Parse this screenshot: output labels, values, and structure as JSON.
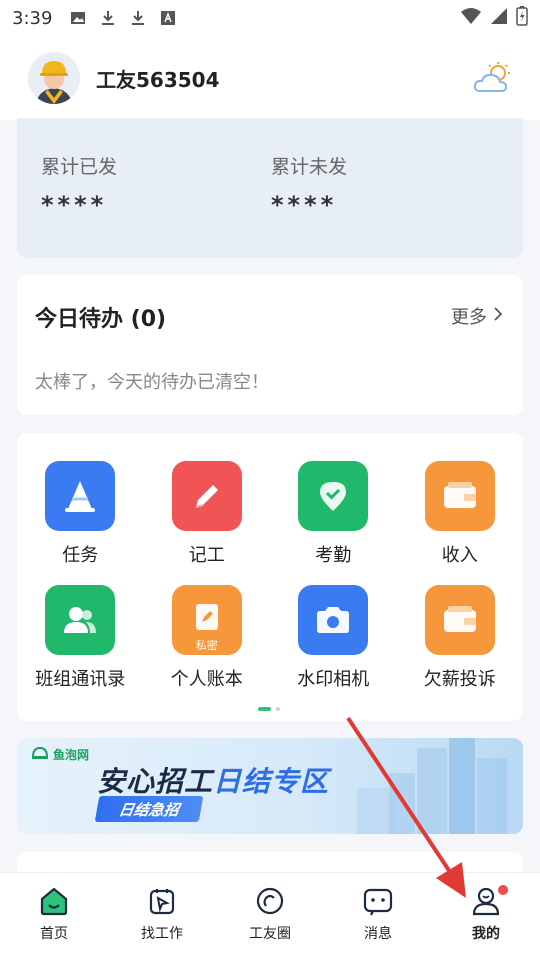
{
  "status_bar": {
    "time": "3:39"
  },
  "user": {
    "name": "工友563504"
  },
  "earnings": {
    "paid_label": "累计已发",
    "paid_value": "****",
    "unpaid_label": "累计未发",
    "unpaid_value": "****"
  },
  "todo": {
    "title": "今日待办 (0)",
    "more": "更多",
    "empty_text": "太棒了，今天的待办已清空！"
  },
  "features": [
    {
      "label": "任务",
      "icon": "cone-icon",
      "color": "#3b7bf2"
    },
    {
      "label": "记工",
      "icon": "pencil-icon",
      "color": "#f05454"
    },
    {
      "label": "考勤",
      "icon": "location-check-icon",
      "color": "#22b86c"
    },
    {
      "label": "收入",
      "icon": "wallet-icon",
      "color": "#f5973a"
    },
    {
      "label": "班组通讯录",
      "icon": "contacts-icon",
      "color": "#22b86c"
    },
    {
      "label": "个人账本",
      "icon": "ledger-icon",
      "color": "#f5973a",
      "tag": "私密"
    },
    {
      "label": "水印相机",
      "icon": "camera-icon",
      "color": "#3b7bf2"
    },
    {
      "label": "欠薪投诉",
      "icon": "wallet-icon",
      "color": "#f5973a"
    }
  ],
  "banner": {
    "logo": "鱼泡网",
    "title_part1": "安心招工",
    "title_part2": "日结专区",
    "subtitle": "日结急招"
  },
  "tabs": [
    {
      "label": "首页",
      "icon": "home-icon"
    },
    {
      "label": "找工作",
      "icon": "find-job-icon"
    },
    {
      "label": "工友圈",
      "icon": "circle-icon"
    },
    {
      "label": "消息",
      "icon": "message-icon"
    },
    {
      "label": "我的",
      "icon": "profile-icon",
      "active": true
    }
  ],
  "colors": {
    "accent": "#22b86c",
    "annotation_arrow": "#e03a34"
  }
}
